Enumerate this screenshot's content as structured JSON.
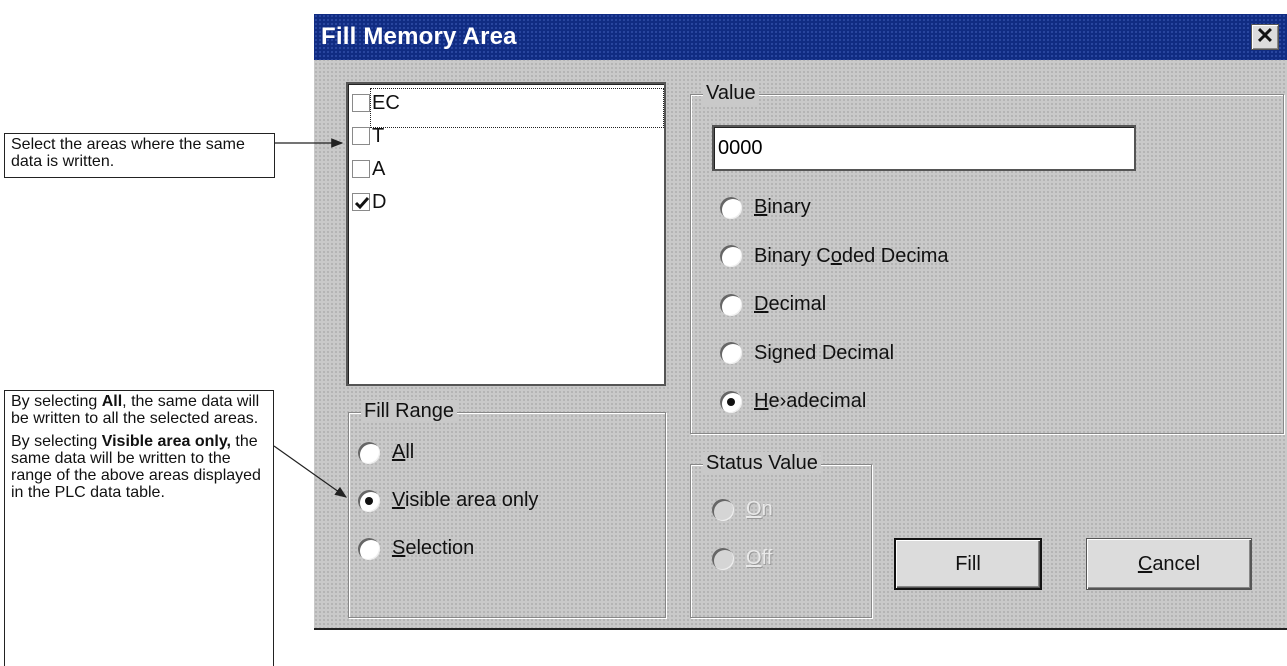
{
  "callouts": {
    "top": "Select the areas where the same data is written.",
    "bottom": {
      "p1_pre": "By selecting ",
      "p1_bold": "All",
      "p1_post": ", the same data will be written to all the selected areas.",
      "p2_bold": "Visible area only,",
      "p2_post": " the same data will be written to the range of the above areas displayed in the PLC data table.",
      "p2_pre": "By selecting "
    }
  },
  "dialog": {
    "title": "Fill Memory Area",
    "close_glyph": "✕",
    "area_list": [
      {
        "label": "EC",
        "checked": false
      },
      {
        "label": "T",
        "checked": false
      },
      {
        "label": "A",
        "checked": false
      },
      {
        "label": "D",
        "checked": true
      }
    ],
    "value_group": {
      "title": "Value",
      "value": "0000",
      "options": [
        {
          "pre": "",
          "ul": "B",
          "post": "inary",
          "selected": false
        },
        {
          "pre": "Binary C",
          "ul": "o",
          "post": "ded Decima",
          "selected": false
        },
        {
          "pre": "",
          "ul": "D",
          "post": "ecimal",
          "selected": false
        },
        {
          "pre": "Si",
          "ul": "g",
          "post": "ned Decimal",
          "selected": false
        },
        {
          "pre": "",
          "ul": "H",
          "post": "e›adecimal",
          "selected": true
        }
      ]
    },
    "fill_range": {
      "title": "Fill Range",
      "options": [
        {
          "pre": "",
          "ul": "A",
          "post": "ll",
          "selected": false
        },
        {
          "pre": "",
          "ul": "V",
          "post": "isible area only",
          "selected": true
        },
        {
          "pre": "",
          "ul": "S",
          "post": "election",
          "selected": false
        }
      ]
    },
    "status_value": {
      "title": "Status Value",
      "options": [
        {
          "pre": "",
          "ul": "O",
          "post": "n",
          "selected": false
        },
        {
          "pre": "",
          "ul": "O",
          "post": "ff",
          "selected": false
        }
      ]
    },
    "fill_button": "Fill",
    "cancel_button": {
      "pre": "",
      "ul": "C",
      "post": "ancel"
    }
  }
}
